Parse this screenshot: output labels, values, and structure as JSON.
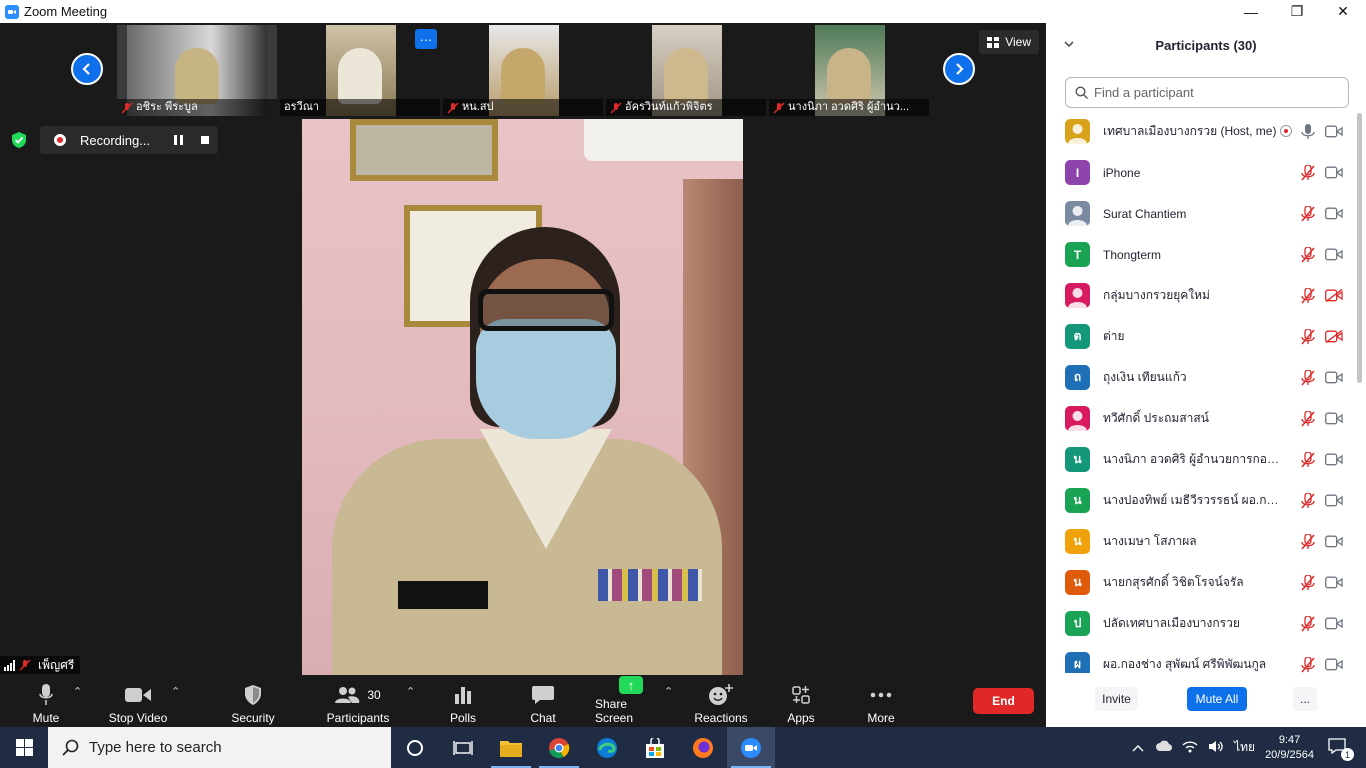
{
  "window": {
    "title": "Zoom Meeting",
    "controls": [
      "—",
      "❐",
      "✕"
    ]
  },
  "strip": {
    "tiles": [
      {
        "name": "อชิระ พีระบูล",
        "muted": true
      },
      {
        "name": "อรวีณา",
        "muted": false
      },
      {
        "name": "หน.สป",
        "muted": true
      },
      {
        "name": "อัครวินท์แก้วพิจิตร",
        "muted": true
      },
      {
        "name": "นางนิภา อวดศิริ  ผู้อำนว...",
        "muted": true
      }
    ],
    "more_label": "···",
    "view_label": "View"
  },
  "recording": {
    "label": "Recording..."
  },
  "self_view": {
    "name": "เพ็ญศรี"
  },
  "toolbar": {
    "mute": "Mute",
    "stop_video": "Stop Video",
    "security": "Security",
    "participants": "Participants",
    "participants_count": "30",
    "polls": "Polls",
    "chat": "Chat",
    "share_screen": "Share Screen",
    "reactions": "Reactions",
    "apps": "Apps",
    "more": "More",
    "end": "End"
  },
  "panel": {
    "title": "Participants (30)",
    "search_placeholder": "Find a participant",
    "participants": [
      {
        "name": "เทศบาลเมืองบางกรวย (Host, me)",
        "initial": "",
        "color": "#d9a21b",
        "mic": "on",
        "cam": "on",
        "recording": true
      },
      {
        "name": "iPhone",
        "initial": "I",
        "color": "#8e44ad",
        "mic": "off",
        "cam": "on"
      },
      {
        "name": "Surat Chantiem",
        "initial": "",
        "color": "#7a8aa0",
        "mic": "off",
        "cam": "on"
      },
      {
        "name": "Thongterm",
        "initial": "T",
        "color": "#1aa355",
        "mic": "off",
        "cam": "on"
      },
      {
        "name": "กลุ่มบางกรวยยุคใหม่",
        "initial": "",
        "color": "#d81b60",
        "mic": "off",
        "cam": "off"
      },
      {
        "name": "ต่าย",
        "initial": "ต",
        "color": "#14967a",
        "mic": "off",
        "cam": "off"
      },
      {
        "name": "ถุงเงิน เทียนแก้ว",
        "initial": "ถ",
        "color": "#1e6fb5",
        "mic": "off",
        "cam": "on"
      },
      {
        "name": "ทวีศักดิ์ ประถมสาสน์",
        "initial": "",
        "color": "#d81b60",
        "mic": "off",
        "cam": "on"
      },
      {
        "name": "นางนิภา อวดศิริ  ผู้อำนวยการกองคลัง",
        "initial": "น",
        "color": "#14967a",
        "mic": "off",
        "cam": "on"
      },
      {
        "name": "นางปองทิพย์ เมธีวีรวรรธน์ ผอ.กองสวัส...",
        "initial": "น",
        "color": "#1aa355",
        "mic": "off",
        "cam": "on"
      },
      {
        "name": "นางเมษา  โสภาผล",
        "initial": "น",
        "color": "#f0a20c",
        "mic": "off",
        "cam": "on"
      },
      {
        "name": "นายกสุรศักดิ์ วิชิตโรจน์จรัล",
        "initial": "น",
        "color": "#e05a0c",
        "mic": "off",
        "cam": "on"
      },
      {
        "name": "ปลัดเทศบาลเมืองบางกรวย",
        "initial": "ป",
        "color": "#1aa355",
        "mic": "off",
        "cam": "on"
      },
      {
        "name": "ผอ.กองช่าง สุพัฒน์ ศรีพิพัฒนกูล",
        "initial": "ผ",
        "color": "#1e6fb5",
        "mic": "off",
        "cam": "on"
      }
    ],
    "invite": "Invite",
    "mute_all": "Mute All",
    "more": "..."
  },
  "taskbar": {
    "search_placeholder": "Type here to search",
    "language": "ไทย",
    "time": "9:47",
    "date": "20/9/2564",
    "notification_count": "1"
  }
}
